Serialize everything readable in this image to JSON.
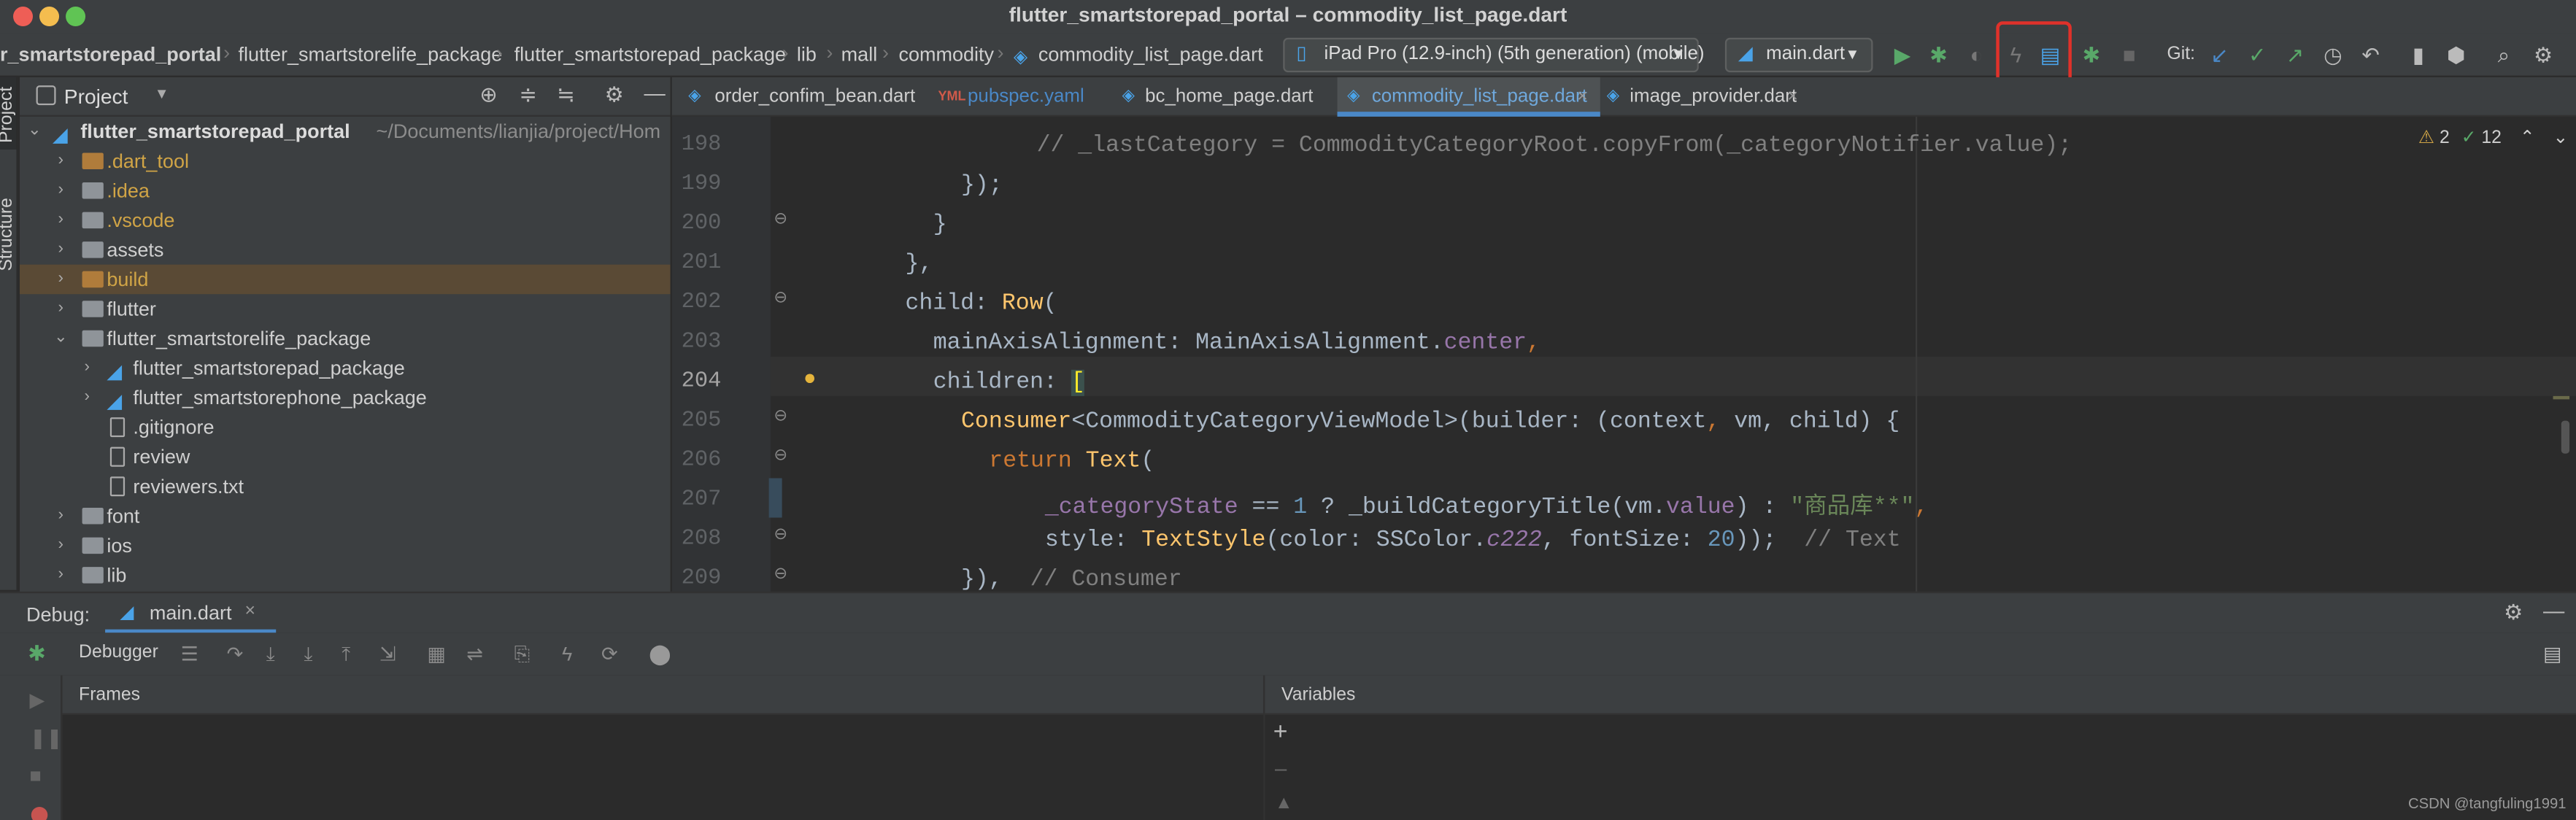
{
  "window": {
    "title": "flutter_smartstorepad_portal – commodity_list_page.dart"
  },
  "breadcrumbs": [
    "r_smartstorepad_portal",
    "flutter_smartstorelife_package",
    "flutter_smartstorepad_package",
    "lib",
    "mall",
    "commodity",
    "commodity_list_page.dart"
  ],
  "toolbar": {
    "device": "iPad Pro (12.9-inch) (5th generation) (mobile)",
    "run_config": "main.dart",
    "git_label": "Git:"
  },
  "project": {
    "title": "Project",
    "root_name": "flutter_smartstorepad_portal",
    "root_path": "~/Documents/lianjia/project/Hom",
    "items": [
      {
        "name": ".dart_tool",
        "type": "folder-excluded"
      },
      {
        "name": ".idea",
        "type": "folder-excluded"
      },
      {
        "name": ".vscode",
        "type": "folder"
      },
      {
        "name": "assets",
        "type": "folder"
      },
      {
        "name": "build",
        "type": "folder-excluded"
      },
      {
        "name": "flutter",
        "type": "folder"
      },
      {
        "name": "flutter_smartstorelife_package",
        "type": "folder"
      },
      {
        "name": "flutter_smartstorepad_package",
        "type": "flutter-module"
      },
      {
        "name": "flutter_smartstorephone_package",
        "type": "flutter-module"
      },
      {
        "name": ".gitignore",
        "type": "file"
      },
      {
        "name": "review",
        "type": "file"
      },
      {
        "name": "reviewers.txt",
        "type": "file"
      },
      {
        "name": "font",
        "type": "folder"
      },
      {
        "name": "ios",
        "type": "folder"
      },
      {
        "name": "lib",
        "type": "folder"
      }
    ]
  },
  "side_strip": {
    "project_label": "Project",
    "structure_label": "Structure"
  },
  "tabs": [
    {
      "label": "order_confim_bean.dart"
    },
    {
      "label": "pubspec.yaml"
    },
    {
      "label": "bc_home_page.dart"
    },
    {
      "label": "commodity_list_page.dart"
    },
    {
      "label": "image_provider.dart"
    }
  ],
  "editor": {
    "warnings": "2",
    "checks": "12",
    "lines": [
      {
        "num": "198"
      },
      {
        "num": "199"
      },
      {
        "num": "200"
      },
      {
        "num": "201"
      },
      {
        "num": "202"
      },
      {
        "num": "203"
      },
      {
        "num": "204"
      },
      {
        "num": "205"
      },
      {
        "num": "206"
      },
      {
        "num": "207"
      },
      {
        "num": "208"
      },
      {
        "num": "209"
      }
    ],
    "code": {
      "l198_comment": "// _lastCategory = CommodityCategoryRoot.copyFrom(_categoryNotifier.value);",
      "l199_a": "});",
      "l200_a": "}",
      "l201_a": "},",
      "l202_a": "child: ",
      "l202_b": "Row",
      "l202_c": "(",
      "l203_a": "mainAxisAlignment: MainAxisAlignment.",
      "l203_b": "center",
      "l203_c": ",",
      "l204_a": "children: ",
      "l204_b": "[",
      "l205_a": "Consumer",
      "l205_b": "<CommodityCategoryViewModel>(builder: (context",
      "l205_c": ", ",
      "l205_d": "vm",
      "l205_e": ", child) {",
      "l206_a": "return ",
      "l206_b": "Text",
      "l206_c": "(",
      "l207_a": "_categoryState",
      "l207_b": " == ",
      "l207_c": "1",
      "l207_d": " ? _buildCategoryTitle(vm.",
      "l207_e": "value",
      "l207_f": ") : ",
      "l207_g": "\"商品库**\"",
      "l207_h": ",",
      "l208_a": "style: ",
      "l208_b": "TextStyle",
      "l208_c": "(color: SSColor.",
      "l208_d": "c222",
      "l208_e": ", fontSize: ",
      "l208_f": "20",
      "l208_g": "));  ",
      "l208_h": "// Text",
      "l209_a": "}),  ",
      "l209_b": "// Consumer"
    }
  },
  "debug": {
    "label": "Debug:",
    "session_tab": "main.dart",
    "debugger_tab": "Debugger",
    "frames_title": "Frames",
    "variables_title": "Variables"
  },
  "watermark": "CSDN @tangfuling1991",
  "colors": {
    "accent": "#4a88c7",
    "highlight_box": "#e0312a",
    "run_green": "#59a869"
  }
}
